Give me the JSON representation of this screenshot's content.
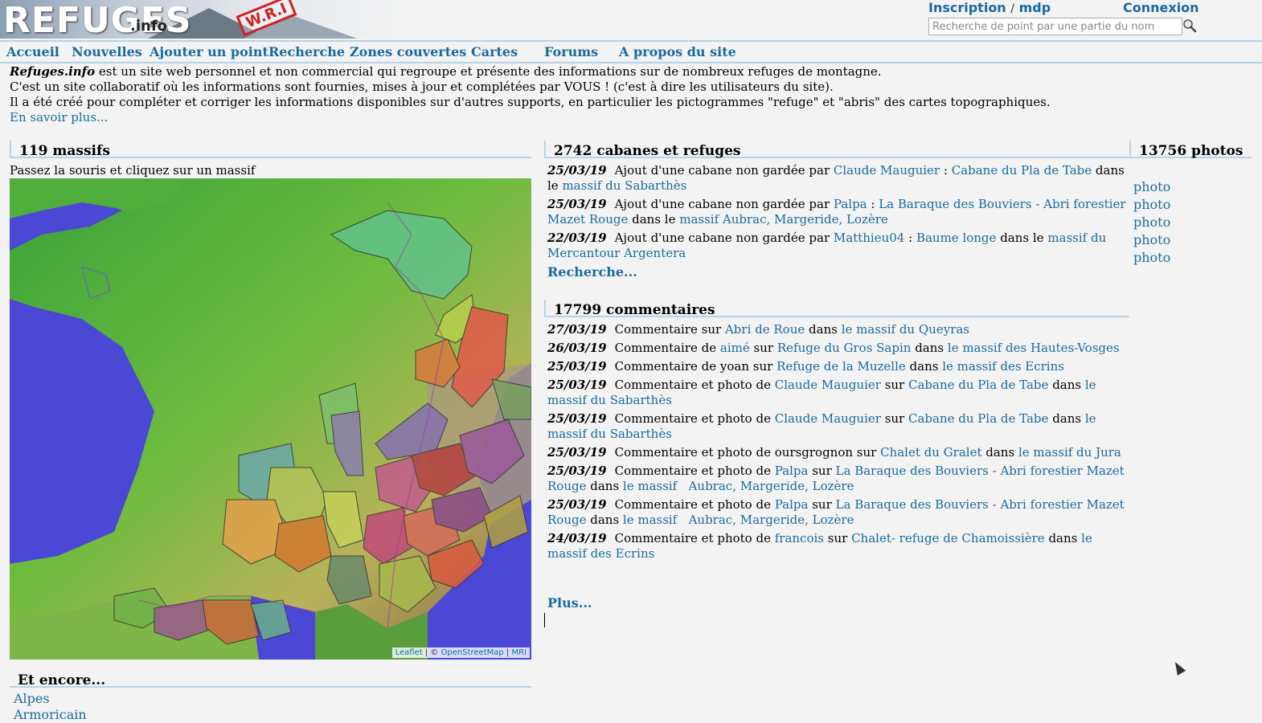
{
  "header": {
    "logo_text": "REFUGES",
    "logo_ext": ".info",
    "stamp_text": "W.R.I",
    "signup": "Inscription",
    "separator": "/",
    "forgot_password": "mdp",
    "login": "Connexion",
    "search_placeholder": "Recherche de point par une partie du nom"
  },
  "menu": [
    "Accueil",
    "Nouvelles",
    "Ajouter un point",
    "Recherche",
    "Zones couvertes",
    "Cartes",
    "Forums",
    "A propos du site"
  ],
  "intro": {
    "site_name": "Refuges.info",
    "line1_rest": " est un site web personnel et non commercial qui regroupe et présente des informations sur de nombreux refuges de montagne.",
    "line2": "C'est un site collaboratif où les informations sont fournies, mises à jour et complétées par VOUS ! (c'est à dire les utilisateurs du site).",
    "line3": "Il a été créé pour compléter et corriger les informations disponibles sur d'autres supports, en particulier les pictogrammes \"refuge\" et \"abris\" des cartes topographiques.",
    "more_link": "En savoir plus..."
  },
  "massifs": {
    "title": "119 massifs",
    "subtitle": "Passez la souris et cliquez sur un massif",
    "attribution": {
      "leaflet": "Leaflet",
      "sep": " | © ",
      "osm": "OpenStreetMap",
      "sep2": " | ",
      "mri": "MRI"
    }
  },
  "huts": {
    "title": "2742 cabanes et refuges",
    "items": [
      {
        "date": "25/03/19",
        "text": "Ajout d'une cabane non gardée par ",
        "user": "Claude Mauguier",
        "sep": " : ",
        "place": "Cabane du Pla de Tabe",
        "in": " dans le ",
        "massif": "massif du Sabarthès"
      },
      {
        "date": "25/03/19",
        "text": "Ajout d'une cabane non gardée par ",
        "user": "Palpa",
        "sep": " : ",
        "place": "La Baraque des Bouviers - Abri forestier Mazet Rouge",
        "in": " dans le ",
        "massif": "massif Aubrac, Margeride, Lozère"
      },
      {
        "date": "22/03/19",
        "text": "Ajout d'une cabane non gardée par ",
        "user": "Matthieu04",
        "sep": " : ",
        "place": "Baume longe",
        "in": " dans le ",
        "massif": "massif du Mercantour Argentera"
      }
    ],
    "more": "Recherche..."
  },
  "comments": {
    "title": "17799 commentaires",
    "items": [
      {
        "date": "27/03/19",
        "pre": "Commentaire sur ",
        "user": "",
        "plain_user": "",
        "on": "",
        "place": "Abri de Roue",
        "in": " dans ",
        "massif": "le massif du Queyras"
      },
      {
        "date": "26/03/19",
        "pre": "Commentaire de ",
        "user": "aimé",
        "plain_user": "",
        "on": " sur ",
        "place": "Refuge du Gros Sapin",
        "in": " dans ",
        "massif": "le massif des Hautes-Vosges"
      },
      {
        "date": "25/03/19",
        "pre": "Commentaire de yoan sur ",
        "user": "",
        "plain_user": "",
        "on": "",
        "place": "Refuge de la Muzelle",
        "in": " dans ",
        "massif": "le massif des Ecrins"
      },
      {
        "date": "25/03/19",
        "pre": "Commentaire et photo de ",
        "user": "Claude Mauguier",
        "plain_user": "",
        "on": " sur ",
        "place": "Cabane du Pla de Tabe",
        "in": " dans ",
        "massif": "le massif du Sabarthès"
      },
      {
        "date": "25/03/19",
        "pre": "Commentaire et photo de ",
        "user": "Claude Mauguier",
        "plain_user": "",
        "on": " sur ",
        "place": "Cabane du Pla de Tabe",
        "in": " dans ",
        "massif": "le massif du Sabarthès"
      },
      {
        "date": "25/03/19",
        "pre": "Commentaire et photo de oursgrognon sur ",
        "user": "",
        "plain_user": "",
        "on": "",
        "place": "Chalet du Gralet",
        "in": " dans ",
        "massif": "le massif du Jura"
      },
      {
        "date": "25/03/19",
        "pre": "Commentaire et photo de ",
        "user": "Palpa",
        "plain_user": "",
        "on": " sur ",
        "place": "La Baraque des Bouviers - Abri forestier Mazet Rouge",
        "in": " dans ",
        "massif": "le massif   Aubrac, Margeride, Lozère"
      },
      {
        "date": "25/03/19",
        "pre": "Commentaire et photo de ",
        "user": "Palpa",
        "plain_user": "",
        "on": " sur ",
        "place": "La Baraque des Bouviers - Abri forestier Mazet Rouge",
        "in": " dans ",
        "massif": "le massif   Aubrac, Margeride, Lozère"
      },
      {
        "date": "24/03/19",
        "pre": "Commentaire et photo de ",
        "user": "francois",
        "plain_user": "",
        "on": " sur ",
        "place": "Chalet- refuge de Chamoissière",
        "in": " dans ",
        "massif": "le massif des Ecrins"
      }
    ],
    "more": "Plus..."
  },
  "photos": {
    "title": "13756 photos",
    "items": [
      "photo",
      "photo",
      "photo",
      "photo",
      "photo"
    ]
  },
  "encore": {
    "title": "Et encore...",
    "items": [
      "Alpes",
      "Armoricain"
    ]
  }
}
